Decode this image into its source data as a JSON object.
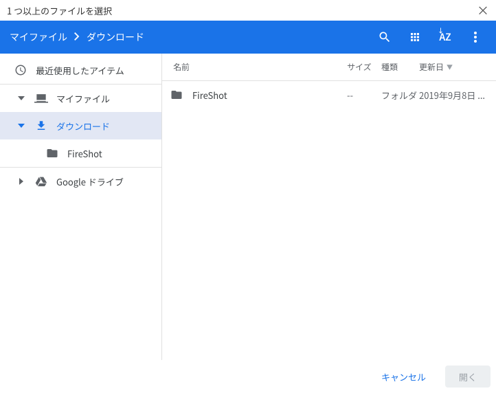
{
  "titlebar": {
    "title": "1 つ以上のファイルを選択"
  },
  "breadcrumb": {
    "root": "マイファイル",
    "current": "ダウンロード"
  },
  "sort_label": "AZ",
  "sidebar": {
    "recent": "最近使用したアイテム",
    "myfiles": "マイファイル",
    "downloads": "ダウンロード",
    "fireshot": "FireShot",
    "gdrive": "Google ドライブ"
  },
  "columns": {
    "name": "名前",
    "size": "サイズ",
    "type": "種類",
    "date": "更新日"
  },
  "files": [
    {
      "name": "FireShot",
      "size": "--",
      "type": "フォルダ",
      "date": "2019年9月8日 ..."
    }
  ],
  "footer": {
    "cancel": "キャンセル",
    "open": "開く"
  }
}
